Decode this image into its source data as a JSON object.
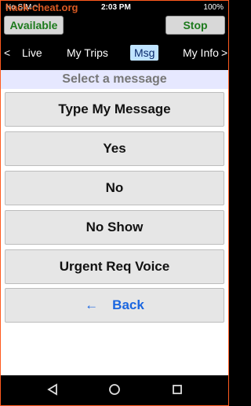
{
  "status_bar": {
    "carrier": "No SIM",
    "time": "2:03 PM",
    "battery": "100%",
    "watermark": "hack-cheat.org"
  },
  "top_buttons": {
    "available": "Available",
    "stop": "Stop"
  },
  "tabs": {
    "left_arrow": "<",
    "right_arrow": ">",
    "items": [
      {
        "label": "Live"
      },
      {
        "label": "My Trips"
      },
      {
        "label": "Msg",
        "selected": true
      },
      {
        "label": "My Info"
      }
    ]
  },
  "heading": "Select a message",
  "messages": [
    {
      "label": "Type My Message"
    },
    {
      "label": "Yes"
    },
    {
      "label": "No"
    },
    {
      "label": "No Show"
    },
    {
      "label": "Urgent Req Voice"
    }
  ],
  "back": {
    "arrow": "←",
    "label": "Back"
  },
  "colors": {
    "frame": "#ff5a1e",
    "available_text": "#1c7a1c",
    "tab_selected_bg": "#bfe3ff",
    "back_text": "#1a66e0",
    "heading_bg": "#e6e8ff"
  },
  "nav_icons": [
    "back-triangle-icon",
    "home-circle-icon",
    "recent-square-icon"
  ]
}
